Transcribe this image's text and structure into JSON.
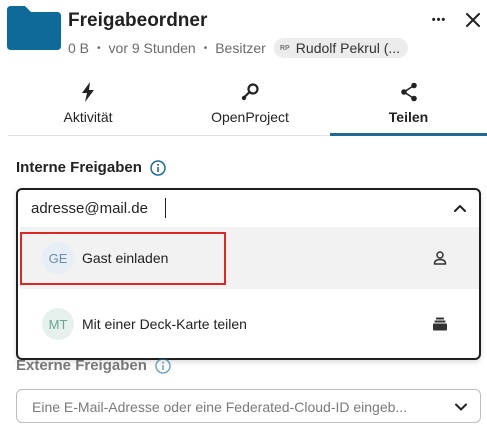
{
  "header": {
    "title": "Freigabeordner",
    "size": "0 B",
    "modified": "vor 9 Stunden",
    "owner_label": "Besitzer",
    "owner_initials": "RP",
    "owner_name": "Rudolf Pekrul (...",
    "more_label": "•••",
    "colors": {
      "folder": "#0f6a9a"
    }
  },
  "tabs": [
    {
      "label": "Aktivität",
      "icon": "lightning-icon"
    },
    {
      "label": "OpenProject",
      "icon": "openproject-icon"
    },
    {
      "label": "Teilen",
      "icon": "share-icon",
      "active": true
    }
  ],
  "internal": {
    "title": "Interne Freigaben",
    "search_value": "adresse@mail.de",
    "options": [
      {
        "initials": "GE",
        "label": "Gast einladen",
        "icon": "user-icon"
      },
      {
        "initials": "MT",
        "label": "Mit einer Deck-Karte teilen",
        "icon": "deck-icon"
      }
    ]
  },
  "external": {
    "title": "Externe Freigaben",
    "placeholder": "Eine E-Mail-Adresse oder eine Federated-Cloud-ID eingeb..."
  },
  "colors": {
    "accent": "#1f6a96",
    "highlight": "#d8282a"
  }
}
